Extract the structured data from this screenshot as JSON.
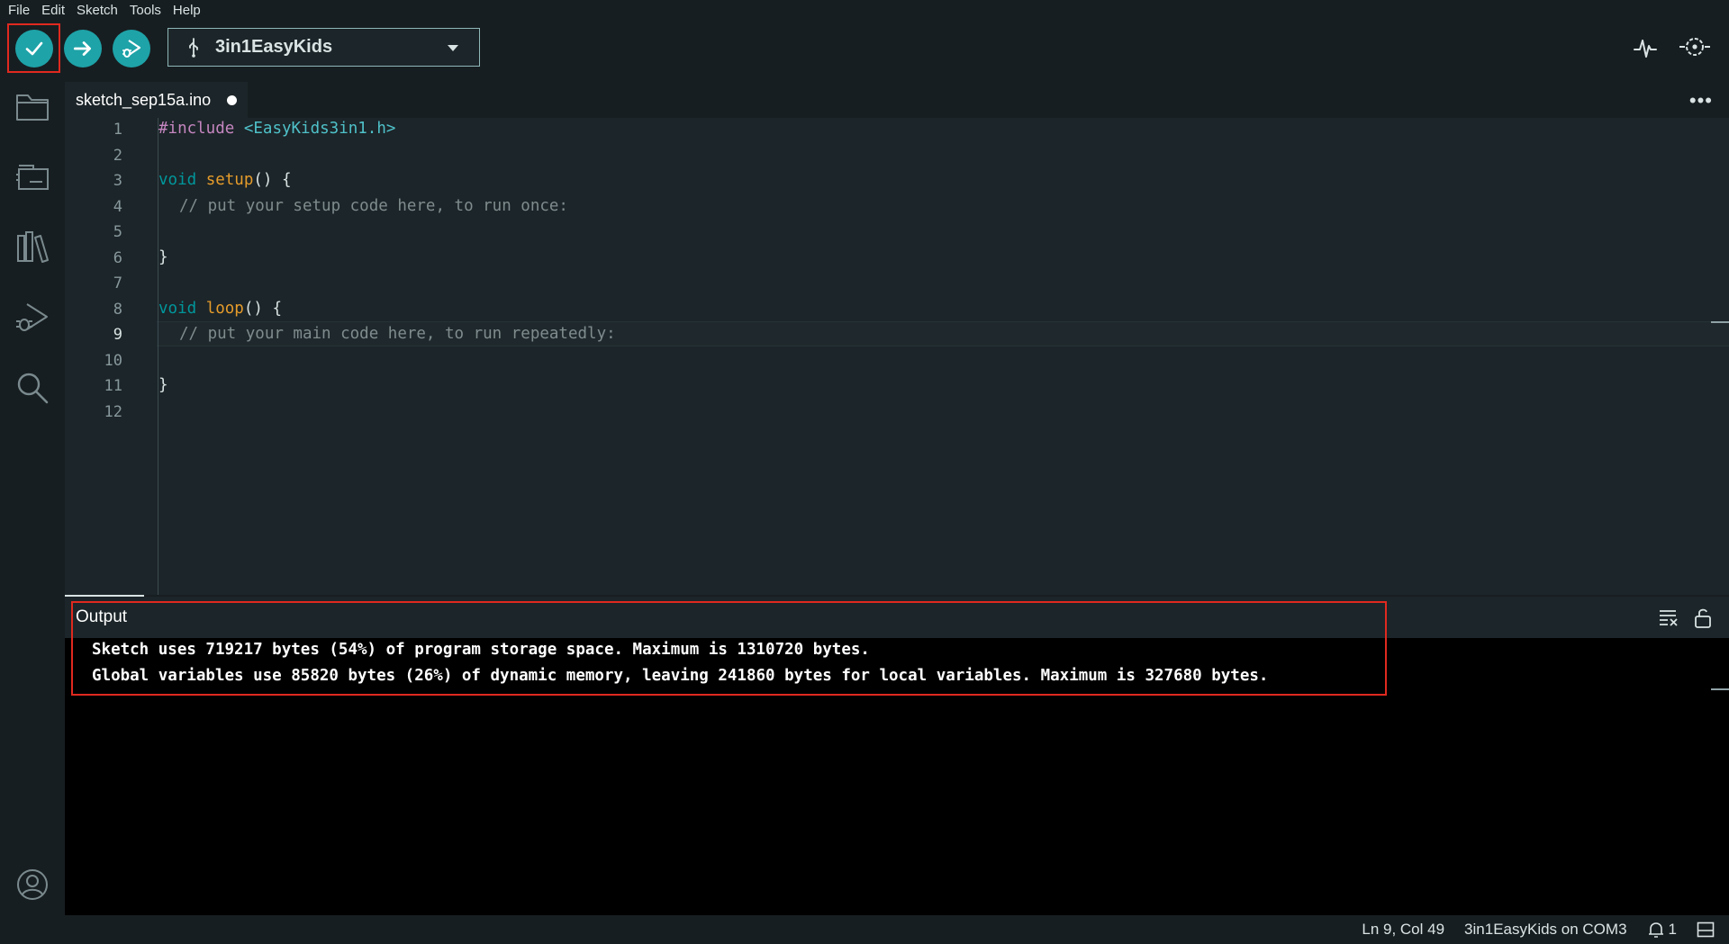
{
  "menu": [
    "File",
    "Edit",
    "Sketch",
    "Tools",
    "Help"
  ],
  "toolbar": {
    "verify_icon": "check-icon",
    "upload_icon": "arrow-right-icon",
    "debug_icon": "debug-icon",
    "board_select": {
      "icon": "usb-icon",
      "label": "3in1EasyKids",
      "dropdown_icon": "chevron-down-icon"
    },
    "serial_plotter_icon": "serial-plotter-icon",
    "serial_monitor_icon": "serial-monitor-icon"
  },
  "activity_bar": [
    "folder-icon",
    "board-manager-icon",
    "library-icon",
    "debug-icon",
    "search-icon",
    "account-icon"
  ],
  "editor": {
    "tab": {
      "filename": "sketch_sep15a.ino",
      "unsaved": true
    },
    "line_numbers": [
      "1",
      "2",
      "3",
      "4",
      "5",
      "6",
      "7",
      "8",
      "9",
      "10",
      "11",
      "12"
    ],
    "active_line": 9,
    "lines": {
      "l1_directive": "#include",
      "l1_header": "<EasyKids3in1.h>",
      "l3_type": "void",
      "l3_fn": "setup",
      "l3_rest": "() {",
      "l4_comment": "// put your setup code here, to run once:",
      "l6_brace": "}",
      "l8_type": "void",
      "l8_fn": "loop",
      "l8_rest": "() {",
      "l9_comment": "// put your main code here, to run repeatedly:",
      "l11_brace": "}"
    }
  },
  "output": {
    "title": "Output",
    "lines": [
      "Sketch uses 719217 bytes (54%) of program storage space. Maximum is 1310720 bytes.",
      "Global variables use 85820 bytes (26%) of dynamic memory, leaving 241860 bytes for local variables. Maximum is 327680 bytes."
    ],
    "clear_icon": "clear-output-icon",
    "lock_icon": "unlock-icon"
  },
  "status": {
    "cursor": "Ln 9, Col 49",
    "board_port": "3in1EasyKids on COM3",
    "notifications": "1",
    "panel_icon": "toggle-panel-icon"
  },
  "colors": {
    "accent": "#1ea3a8",
    "highlight": "#e0291f",
    "background": "#171e21",
    "editor_bg": "#1c2529"
  }
}
